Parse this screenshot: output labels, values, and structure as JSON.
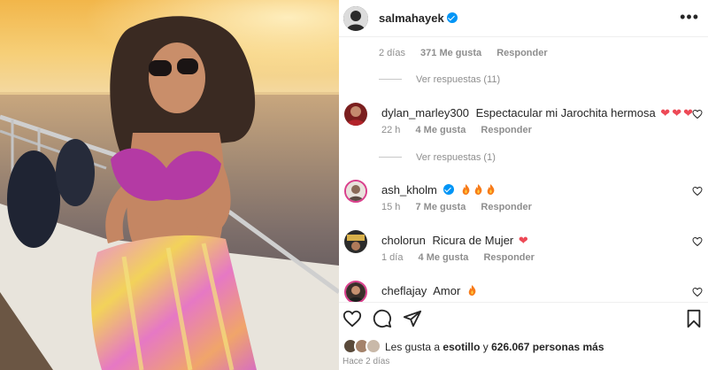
{
  "header": {
    "username": "salmahayek"
  },
  "comments_area": {
    "top_meta": {
      "time": "2 días",
      "likes": "371 Me gusta",
      "reply": "Responder"
    },
    "view_replies_1": "Ver respuestas (11)",
    "comments": [
      {
        "username": "dylan_marley300",
        "text": "Espectacular mi Jarochita hermosa",
        "emoji": "hearts",
        "time": "22 h",
        "likes": "4 Me gusta",
        "reply": "Responder",
        "view_replies": "Ver respuestas (1)"
      },
      {
        "username": "ash_kholm",
        "text": "",
        "emoji": "fire",
        "time": "15 h",
        "likes": "7 Me gusta",
        "reply": "Responder"
      },
      {
        "username": "cholorun",
        "text": "Ricura de Mujer",
        "emoji": "heart",
        "time": "1 día",
        "likes": "4 Me gusta",
        "reply": "Responder"
      },
      {
        "username": "cheflajay",
        "text": "Amor",
        "emoji": "fire"
      }
    ]
  },
  "likes": {
    "prefix": "Les gusta a",
    "user": "esotillo",
    "connector": "y",
    "others": "626.067 personas más"
  },
  "timestamp": "Hace 2 días",
  "colors": {
    "verified": "#0095f6",
    "heart": "#ed4956",
    "secondary_text": "#8e8e8e"
  },
  "icons": [
    "verified-badge-icon",
    "more-options-icon",
    "heart-icon",
    "comment-icon",
    "share-icon",
    "bookmark-icon",
    "fire-icon"
  ]
}
